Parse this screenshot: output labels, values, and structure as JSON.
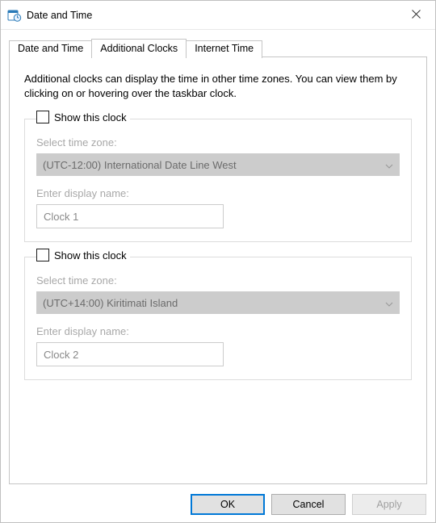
{
  "window": {
    "title": "Date and Time"
  },
  "tabs": {
    "t0": "Date and Time",
    "t1": "Additional Clocks",
    "t2": "Internet Time",
    "active_index": 1
  },
  "panel": {
    "description": "Additional clocks can display the time in other time zones. You can view them by clicking on or hovering over the taskbar clock."
  },
  "clocks": [
    {
      "show_label": "Show this clock",
      "checked": false,
      "tz_label": "Select time zone:",
      "tz_value": "(UTC-12:00) International Date Line West",
      "name_label": "Enter display name:",
      "name_value": "Clock 1"
    },
    {
      "show_label": "Show this clock",
      "checked": false,
      "tz_label": "Select time zone:",
      "tz_value": "(UTC+14:00) Kiritimati Island",
      "name_label": "Enter display name:",
      "name_value": "Clock 2"
    }
  ],
  "buttons": {
    "ok": "OK",
    "cancel": "Cancel",
    "apply": "Apply"
  }
}
